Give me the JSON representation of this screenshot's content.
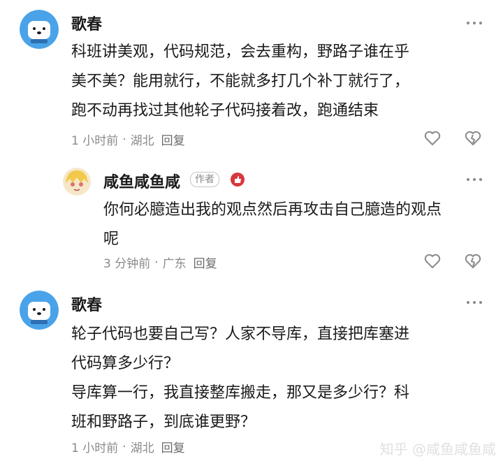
{
  "comments": [
    {
      "author": "歌春",
      "lines": [
        "科班讲美观，代码规范，会去重构，野路子谁在乎",
        "美不美？能用就行，不能就多打几个补丁就行了，",
        "跑不动再找过其他轮子代码接着改，跑通结束"
      ],
      "time": "1 小时前",
      "sep": "·",
      "location": "湖北",
      "reply_label": "回复"
    },
    {
      "author": "咸鱼咸鱼咸",
      "author_tag": "作者",
      "lines": [
        "你何必臆造出我的观点然后再攻击自己臆造的观点",
        "呢"
      ],
      "time": "3 分钟前",
      "sep": "·",
      "location": "广东",
      "reply_label": "回复"
    },
    {
      "author": "歌春",
      "lines": [
        "轮子代码也要自己写？人家不导库，直接把库塞进",
        "代码算多少行？",
        "导库算一行，我直接整库搬走，那又是多少行？科",
        "班和野路子，到底谁更野？"
      ],
      "time": "1 小时前",
      "sep": "·",
      "location": "湖北",
      "reply_label": "回复"
    }
  ],
  "watermark": "知乎 @咸鱼咸鱼咸",
  "colors": {
    "text": "#1a1a1a",
    "meta": "#8a8a8a",
    "badge": "#d6383c",
    "avatar_bg": "#4aa3e8"
  },
  "icons": [
    "more-icon",
    "heart-icon",
    "broken-heart-icon",
    "dog-avatar",
    "anime-avatar",
    "author-badge-icon"
  ]
}
